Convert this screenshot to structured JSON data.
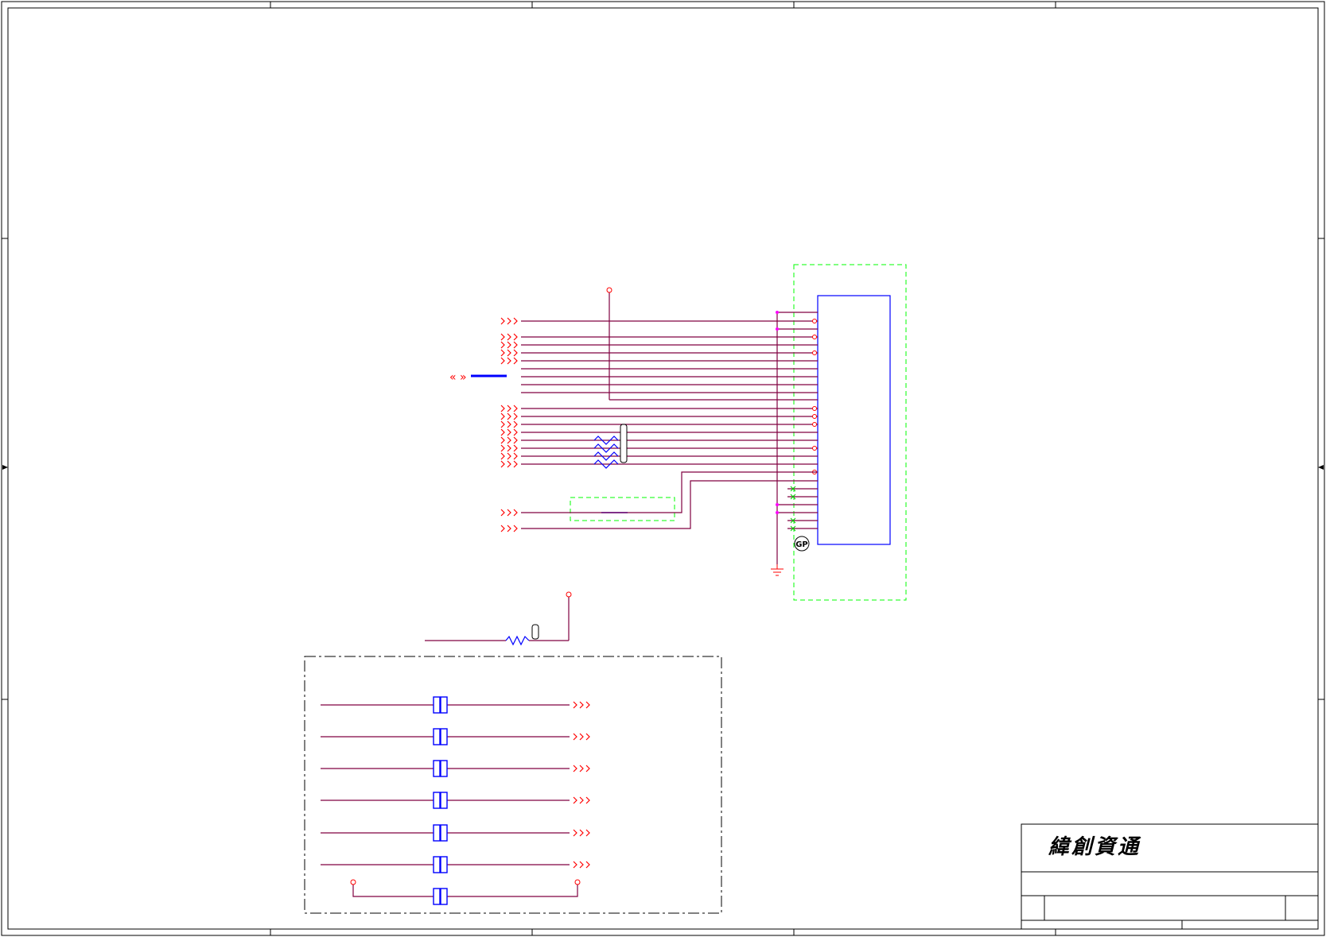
{
  "title_block": {
    "company": "緯創資通"
  },
  "markers": {
    "gp_label": "GP"
  },
  "colors": {
    "wire": "#800040",
    "net_arrow": "#ff0000",
    "component": "#0000ff",
    "junction": "#ff00ff",
    "dashed_box": "#00ff00",
    "frame": "#000000"
  }
}
